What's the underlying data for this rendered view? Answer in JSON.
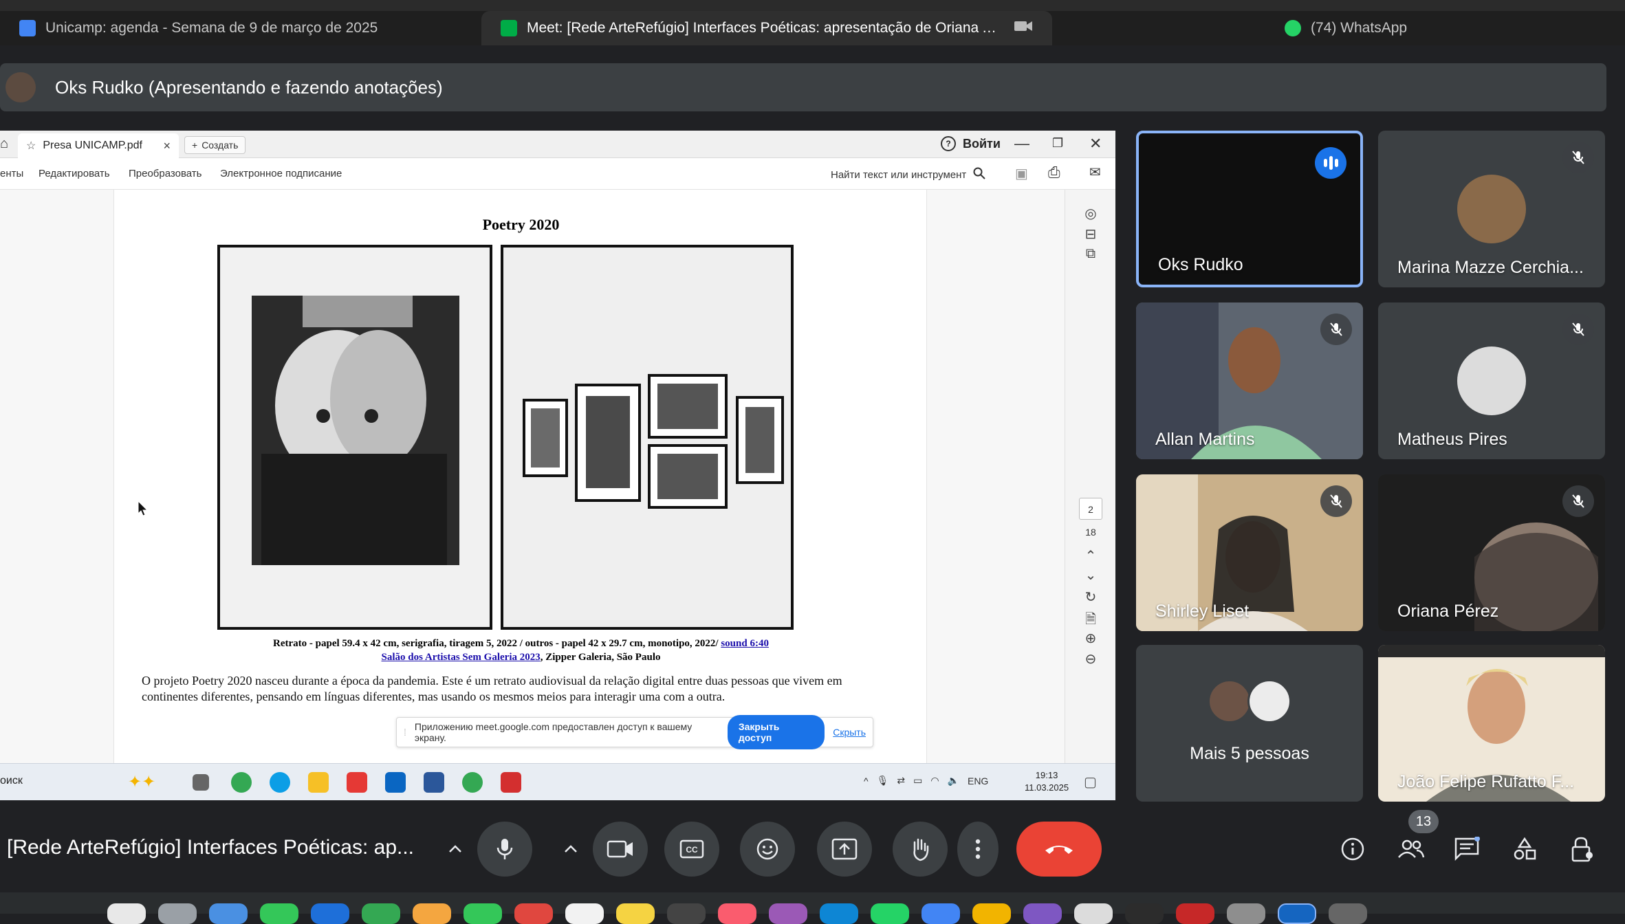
{
  "browser": {
    "tabs": [
      {
        "label": "Unicamp: agenda - Semana de 9 de março de 2025",
        "favicon": "calendar-icon",
        "color": "#4285f4"
      },
      {
        "label": "Meet: [Rede ArteRefúgio] Interfaces Poéticas: apresentação de Oriana A. Pere...",
        "favicon": "meet-icon",
        "color": "#00ac47"
      },
      {
        "label": "(74) WhatsApp",
        "favicon": "whatsapp-icon",
        "color": "#25d366"
      }
    ]
  },
  "presenter_banner": {
    "text": "Oks Rudko (Apresentando e fazendo anotações)"
  },
  "shared_screen": {
    "pdf_tab_label": "Presa UNICAMP.pdf",
    "new_tab_label": "Создать",
    "sign_in_label": "Войти",
    "menu": [
      "енты",
      "Редактировать",
      "Преобразовать",
      "Электронное подписание"
    ],
    "find_placeholder": "Найти текст или инструмент",
    "page_title": "Poetry 2020",
    "caption_line1": "Retrato - papel 59.4 x 42 cm, serigrafia, tiragem 5, 2022 / outros - papel 42 x 29.7 cm, monotipo, 2022/ ",
    "caption_link1": "sound 6:40",
    "caption_link2": "Salão dos Artistas Sem Galeria 2023",
    "caption_line2_rest": ", Zipper Galeria, São Paulo",
    "paragraph": "O projeto Poetry 2020 nasceu durante a época da pandemia. Este é um retrato audiovisual da relação digital entre duas pessoas que vivem em continentes diferentes, pensando em línguas diferentes, mas usando os mesmos meios para interagir uma com a outra.",
    "share_notice": {
      "text": "Приложению meet.google.com предоставлен доступ к вашему экрану.",
      "stop_label": "Закрыть доступ",
      "hide_label": "Скрыть"
    },
    "page_number": "2",
    "page_count": "18",
    "taskbar": {
      "search_label": "оиск",
      "lang": "ENG",
      "time": "19:13",
      "date": "11.03.2025"
    }
  },
  "participants": [
    {
      "name": "Oks Rudko",
      "state": "speaking",
      "accent": "#8ab4f8"
    },
    {
      "name": "Marina Mazze Cerchia...",
      "state": "muted"
    },
    {
      "name": "Allan Martins",
      "state": "muted"
    },
    {
      "name": "Matheus Pires",
      "state": "muted"
    },
    {
      "name": "Shirley Liset",
      "state": "muted"
    },
    {
      "name": "Oriana Pérez",
      "state": "muted"
    },
    {
      "name": "Mais 5 pessoas",
      "state": "group"
    },
    {
      "name": "João Felipe Rufatto F...",
      "state": "video"
    }
  ],
  "controls": {
    "meeting_title": "[Rede ArteRefúgio] Interfaces Poéticas: ap...",
    "people_count": "13",
    "leave_color": "#ea4335"
  }
}
